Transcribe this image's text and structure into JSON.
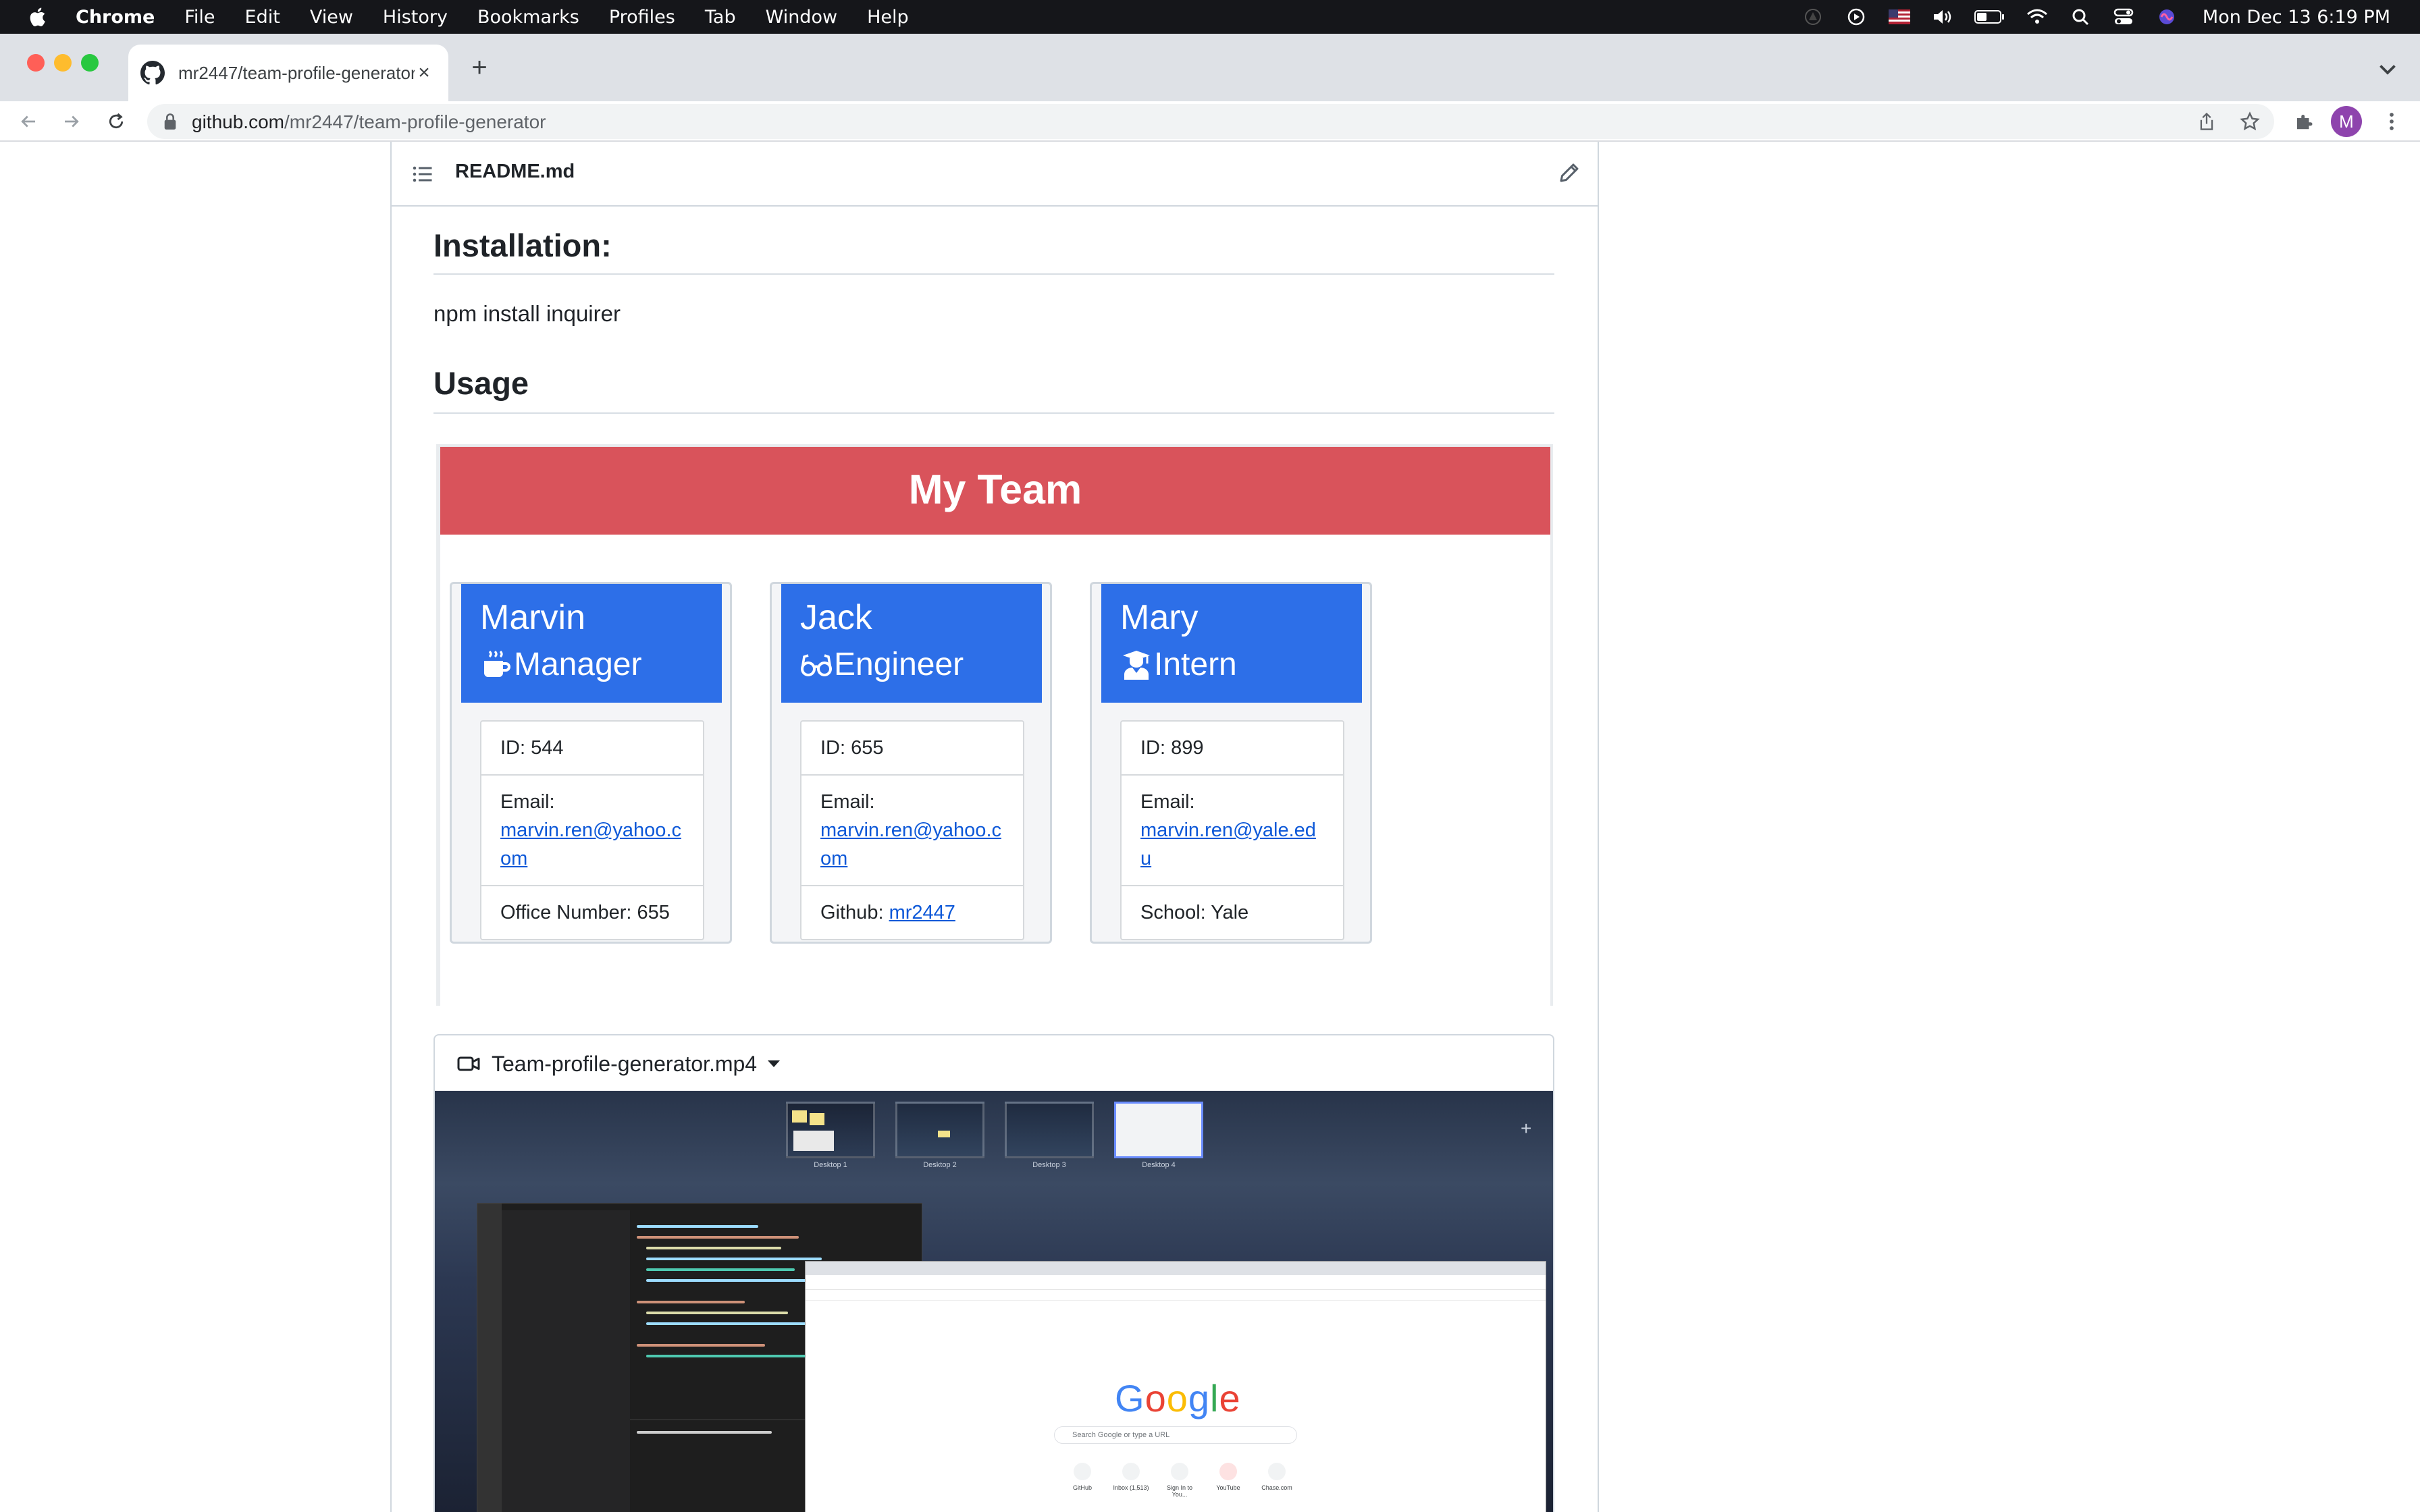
{
  "menubar": {
    "app": "Chrome",
    "items": [
      "File",
      "Edit",
      "View",
      "History",
      "Bookmarks",
      "Profiles",
      "Tab",
      "Window",
      "Help"
    ],
    "clock": "Mon Dec 13  6:19 PM"
  },
  "browser": {
    "tab_title": "mr2447/team-profile-generator",
    "url_host": "github.com",
    "url_path": "/mr2447/team-profile-generator",
    "profile_initial": "M"
  },
  "readme": {
    "filename": "README.md",
    "installation_heading": "Installation:",
    "installation_text": "npm install inquirer",
    "usage_heading": "Usage"
  },
  "team": {
    "banner": "My Team",
    "members": [
      {
        "name": "Marvin",
        "role": "Manager",
        "role_icon": "coffee-mug-icon",
        "id": "ID: 544",
        "email_label": "Email:",
        "email": "marvin.ren@yahoo.com",
        "extra_label": "Office Number: 655",
        "extra_link": ""
      },
      {
        "name": "Jack",
        "role": "Engineer",
        "role_icon": "glasses-icon",
        "id": "ID: 655",
        "email_label": "Email:",
        "email": "marvin.ren@yahoo.com",
        "extra_label": "Github: ",
        "extra_link": "mr2447"
      },
      {
        "name": "Mary",
        "role": "Intern",
        "role_icon": "graduate-icon",
        "id": "ID: 899",
        "email_label": "Email:",
        "email": "marvin.ren@yale.edu",
        "extra_label": "School: Yale",
        "extra_link": ""
      }
    ]
  },
  "video": {
    "filename": "Team-profile-generator.mp4",
    "desktops": [
      "Desktop 1",
      "Desktop 2",
      "Desktop 3",
      "Desktop 4"
    ],
    "google_logo": "Google",
    "google_search_placeholder": "Search Google or type a URL",
    "shortcuts": [
      "GitHub",
      "Inbox (1,513)",
      "Sign In to You...",
      "YouTube",
      "Chase.com"
    ]
  },
  "colors": {
    "banner_red": "#d9535b",
    "card_blue": "#2d6fe8",
    "link_blue": "#0d58d8"
  }
}
